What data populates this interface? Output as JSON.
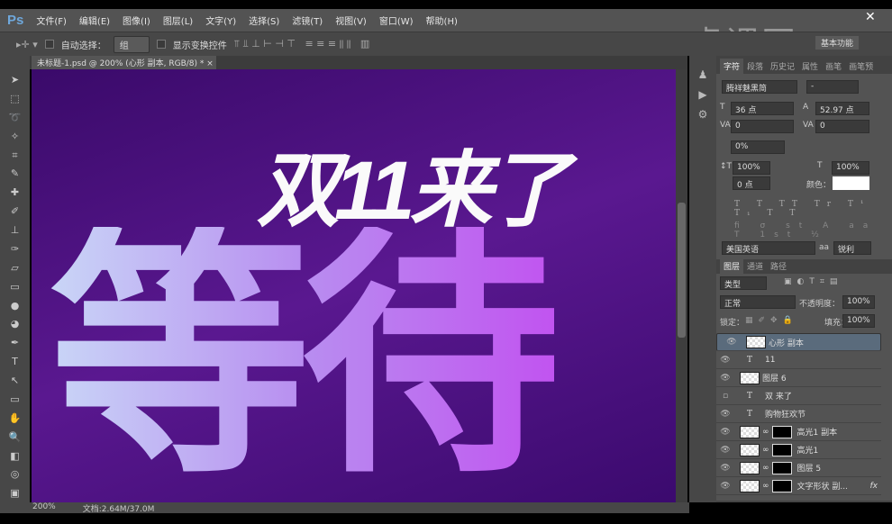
{
  "app": {
    "logo": "Ps",
    "close": "✕",
    "workspace": "基本功能",
    "watermark": "虎课网"
  },
  "menu": [
    "文件(F)",
    "编辑(E)",
    "图像(I)",
    "图层(L)",
    "文字(Y)",
    "选择(S)",
    "滤镜(T)",
    "视图(V)",
    "窗口(W)",
    "帮助(H)"
  ],
  "options": {
    "auto_select_label": "自动选择：",
    "auto_select_value": "组",
    "show_transform": "显示变换控件"
  },
  "document": {
    "tab": "未标题-1.psd @ 200% (心形 副本, RGB/8) *",
    "tab_close": "×",
    "canvas_text_top": "双11来了",
    "canvas_text_main": "等待"
  },
  "status": {
    "zoom": "200%",
    "doc": "文档:2.64M/37.0M"
  },
  "char_panel": {
    "tabs": [
      "字符",
      "段落",
      "历史记",
      "属性",
      "画笔",
      "画笔预"
    ],
    "font": "腾祥魅黑简",
    "style": "-",
    "size": "36 点",
    "leading": "52.97 点",
    "kerning": "0",
    "tracking": "0",
    "scale": "0%",
    "vscale": "100%",
    "hscale": "100%",
    "baseline": "0 点",
    "color_label": "颜色：",
    "language": "美国英语",
    "aa_label": "aa",
    "antialias": "锐利",
    "color": "#ffffff"
  },
  "layers_panel": {
    "tabs": [
      "图层",
      "通道",
      "路径"
    ],
    "filter": "类型",
    "blend": "正常",
    "opacity_label": "不透明度：",
    "opacity": "100%",
    "lock_label": "锁定：",
    "fill_label": "填充：",
    "fill": "100%",
    "layers": [
      {
        "name": "心形 副本",
        "type": "smart",
        "visible": true,
        "selected": true
      },
      {
        "name": "11",
        "type": "text",
        "visible": true
      },
      {
        "name": "图层 6",
        "type": "pixel",
        "visible": true
      },
      {
        "name": "双 来了",
        "type": "text",
        "visible": false
      },
      {
        "name": "购物狂欢节",
        "type": "text",
        "visible": true
      },
      {
        "name": "高光1 副本",
        "type": "mask",
        "visible": true
      },
      {
        "name": "高光1",
        "type": "mask",
        "visible": true
      },
      {
        "name": "图层 5",
        "type": "mask",
        "visible": true
      },
      {
        "name": "文字形状 副...",
        "type": "mask",
        "visible": true,
        "fx": "fx"
      }
    ]
  }
}
